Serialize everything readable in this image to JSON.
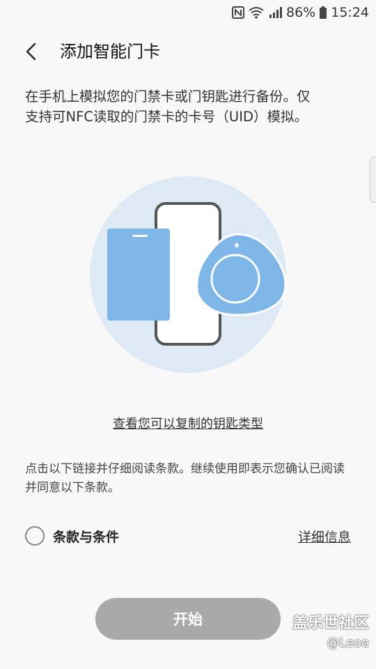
{
  "status_bar": {
    "icons": [
      "nfc-icon",
      "wifi-icon",
      "signal-icon"
    ],
    "battery": "86%",
    "time": "15:24"
  },
  "header": {
    "title": "添加智能门卡"
  },
  "description": "在手机上模拟您的门禁卡或门钥匙进行备份。仅支持可NFC读取的门禁卡的卡号（UID）模拟。",
  "link_keys": "查看您可以复制的钥匙类型",
  "terms_note": "点击以下链接并仔细阅读条款。继续使用即表示您确认已阅读并同意以下条款。",
  "terms": {
    "label": "条款与条件",
    "details": "详细信息",
    "checked": false
  },
  "start_button": "开始",
  "watermark": {
    "line1": "盖乐世社区",
    "line2": "@Leoe"
  },
  "colors": {
    "background": "#f8f8f8",
    "card_blue": "#7fb6e8",
    "circle_light": "#dde9f5",
    "button_disabled": "#a9a9a9"
  }
}
